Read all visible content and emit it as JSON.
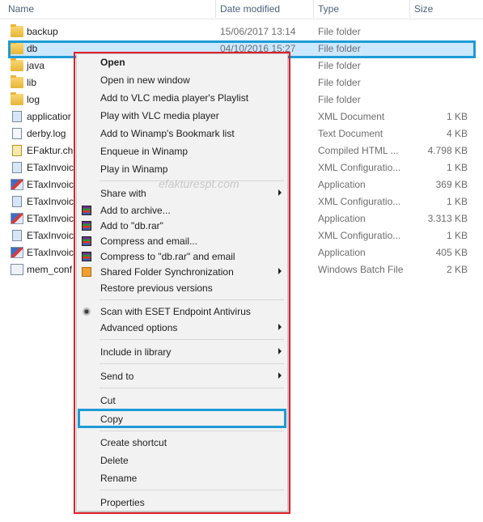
{
  "columns": {
    "name": "Name",
    "date": "Date modified",
    "type": "Type",
    "size": "Size"
  },
  "files": [
    {
      "name": "backup",
      "date": "15/06/2017 13:14",
      "type": "File folder",
      "size": "",
      "icon": "folder-icon"
    },
    {
      "name": "db",
      "date": "04/10/2016 15:27",
      "type": "File folder",
      "size": "",
      "icon": "folder-icon"
    },
    {
      "name": "java",
      "date": "",
      "type": "File folder",
      "size": "",
      "icon": "folder-icon"
    },
    {
      "name": "lib",
      "date": "",
      "type": "File folder",
      "size": "",
      "icon": "folder-icon"
    },
    {
      "name": "log",
      "date": "",
      "type": "File folder",
      "size": "",
      "icon": "folder-icon"
    },
    {
      "name": "applicatior",
      "date": "",
      "type": "XML Document",
      "size": "1 KB",
      "icon": "xml-file-icon"
    },
    {
      "name": "derby.log",
      "date": "",
      "type": "Text Document",
      "size": "4 KB",
      "icon": "text-file-icon"
    },
    {
      "name": "EFaktur.ch",
      "date": "",
      "type": "Compiled HTML ...",
      "size": "4.798 KB",
      "icon": "chm-file-icon"
    },
    {
      "name": "ETaxInvoic",
      "date": "",
      "type": "XML Configuratio...",
      "size": "1 KB",
      "icon": "config-file-icon"
    },
    {
      "name": "ETaxInvoic",
      "date": "",
      "type": "Application",
      "size": "369 KB",
      "icon": "application-icon"
    },
    {
      "name": "ETaxInvoic",
      "date": "",
      "type": "XML Configuratio...",
      "size": "1 KB",
      "icon": "config-file-icon"
    },
    {
      "name": "ETaxInvoic",
      "date": "",
      "type": "Application",
      "size": "3.313 KB",
      "icon": "application-icon"
    },
    {
      "name": "ETaxInvoic",
      "date": "",
      "type": "XML Configuratio...",
      "size": "1 KB",
      "icon": "config-file-icon"
    },
    {
      "name": "ETaxInvoic",
      "date": "",
      "type": "Application",
      "size": "405 KB",
      "icon": "application-icon"
    },
    {
      "name": "mem_conf",
      "date": "",
      "type": "Windows Batch File",
      "size": "2 KB",
      "icon": "batch-file-icon"
    }
  ],
  "menu": {
    "open": "Open",
    "open_new_window": "Open in new window",
    "vlc_playlist": "Add to VLC media player's Playlist",
    "vlc_play": "Play with VLC media player",
    "winamp_bookmark": "Add to Winamp's Bookmark list",
    "winamp_enqueue": "Enqueue in Winamp",
    "winamp_play": "Play in Winamp",
    "share_with": "Share with",
    "add_archive": "Add to archive...",
    "add_dbrar": "Add to \"db.rar\"",
    "compress_email": "Compress and email...",
    "compress_dbrar_email": "Compress to \"db.rar\" and email",
    "shared_sync": "Shared Folder Synchronization",
    "restore": "Restore previous versions",
    "eset_scan": "Scan with ESET Endpoint Antivirus",
    "advanced": "Advanced options",
    "include_library": "Include in library",
    "send_to": "Send to",
    "cut": "Cut",
    "copy": "Copy",
    "create_shortcut": "Create shortcut",
    "delete": "Delete",
    "rename": "Rename",
    "properties": "Properties"
  },
  "watermark": "efakturespt.com",
  "colors": {
    "selection": "#cce8ff",
    "highlight_outline": "#1e9bd6",
    "menu_outline": "#e0202a"
  }
}
